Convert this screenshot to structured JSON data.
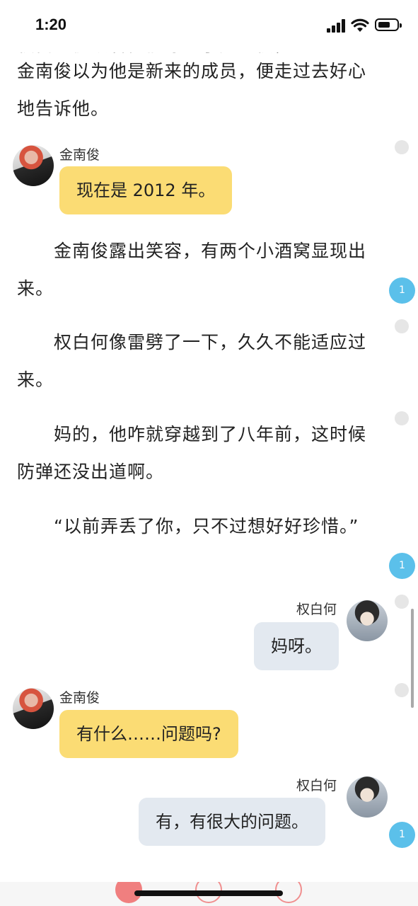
{
  "status_bar": {
    "time": "1:20"
  },
  "story": {
    "cut_line": "权白何便跟着他们穿到了办公楼，",
    "paragraphs": [
      "金南俊以为他是新来的成员，便走过去好心地告诉他。",
      "　　金南俊露出笑容，有两个小酒窝显现出来。",
      "　　权白何像雷劈了一下，久久不能适应过来。",
      "　　妈的，他咋就穿越到了八年前，这时候防弹还没出道啊。",
      "　　“以前弄丢了你，只不过想好好珍惜。”"
    ]
  },
  "chat": {
    "msg1": {
      "speaker": "金南俊",
      "text": "现在是 2012 年。"
    },
    "msg2": {
      "speaker": "权白何",
      "text": "妈呀。"
    },
    "msg3": {
      "speaker": "金南俊",
      "text": "有什么……问题吗?"
    },
    "msg4": {
      "speaker": "权白何",
      "text": "有，有很大的问题。"
    }
  },
  "comments": {
    "badge1": "1",
    "badge2": "1",
    "badge3": "1"
  },
  "colors": {
    "bubble_left": "#fbdc74",
    "bubble_right": "#e3e9f0",
    "comment_badge": "#5bc0ea",
    "action_accent": "#f07f7f"
  },
  "icons": [
    "signal-icon",
    "wifi-icon",
    "battery-icon",
    "comment-dot",
    "comment-badge"
  ]
}
